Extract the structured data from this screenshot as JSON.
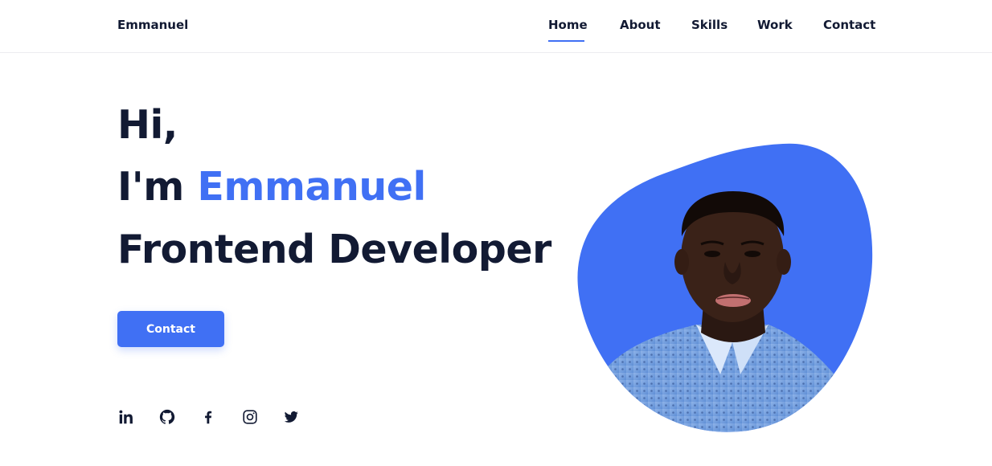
{
  "header": {
    "brand": "Emmanuel",
    "nav": [
      {
        "label": "Home",
        "active": true
      },
      {
        "label": "About",
        "active": false
      },
      {
        "label": "Skills",
        "active": false
      },
      {
        "label": "Work",
        "active": false
      },
      {
        "label": "Contact",
        "active": false
      }
    ]
  },
  "hero": {
    "greeting": "Hi,",
    "intro_prefix": "I'm ",
    "name": "Emmanuel",
    "role": "Frontend Developer",
    "button_label": "Contact"
  },
  "socials": [
    {
      "icon": "linkedin-icon"
    },
    {
      "icon": "github-icon"
    },
    {
      "icon": "facebook-icon"
    },
    {
      "icon": "instagram-icon"
    },
    {
      "icon": "twitter-icon"
    }
  ],
  "colors": {
    "accent": "#4070f4",
    "text": "#121a33"
  }
}
